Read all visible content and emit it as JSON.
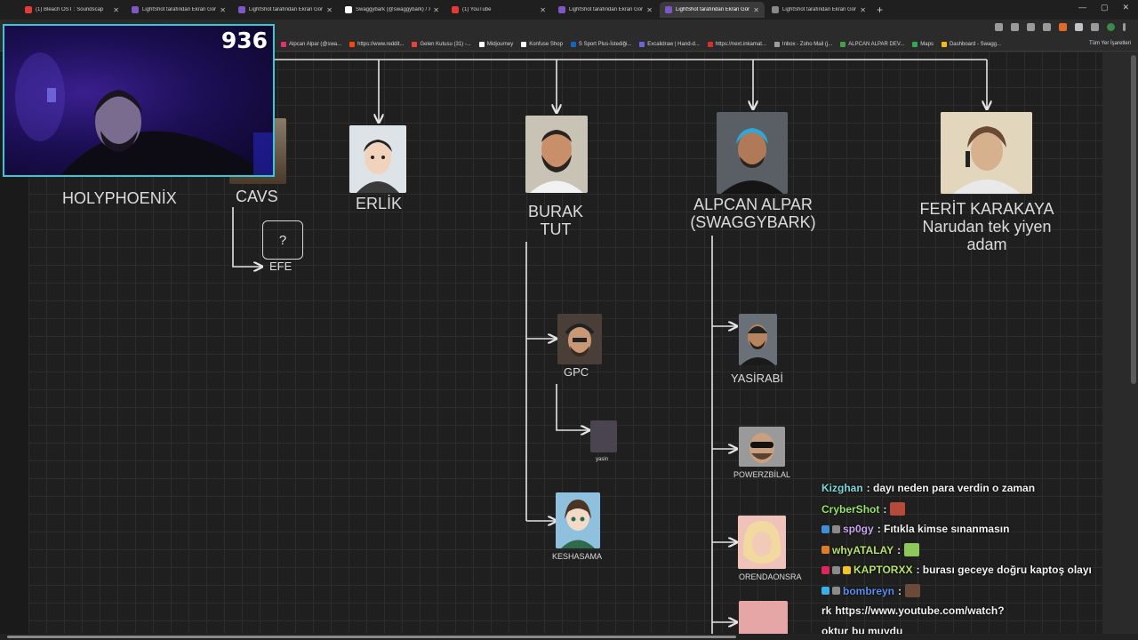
{
  "browser": {
    "tabs": [
      {
        "title": "(1) Bleach OST : Soundscap",
        "fav": "#e53935",
        "active": false
      },
      {
        "title": "LightShot tarafından Ekran Gör",
        "fav": "#7e57c2",
        "active": false
      },
      {
        "title": "LightShot tarafından Ekran Gör",
        "fav": "#7e57c2",
        "active": false
      },
      {
        "title": "Swaggybark (@swaggybark) / X",
        "fav": "#ffffff",
        "active": false
      },
      {
        "title": "(1) YouTube",
        "fav": "#e53935",
        "active": false
      },
      {
        "title": "LightShot tarafından Ekran Gör",
        "fav": "#7e57c2",
        "active": false
      },
      {
        "title": "LightShot tarafından Ekran Gör",
        "fav": "#7e57c2",
        "active": true
      },
      {
        "title": "LightShot tarafından Ekran Gör",
        "fav": "#888888",
        "active": false
      }
    ],
    "new_tab": "+",
    "window_controls": [
      "—",
      "▢",
      "✕"
    ],
    "bookmarks": [
      {
        "label": "Alpcan Alpar (@swa...",
        "color": "#e1306c"
      },
      {
        "label": "https://www.reddit...",
        "color": "#ff4500"
      },
      {
        "label": "Gelen Kutusu (31) -...",
        "color": "#ea4335"
      },
      {
        "label": "Midjourney",
        "color": "#ffffff"
      },
      {
        "label": "Konfuse Shop",
        "color": "#ffffff"
      },
      {
        "label": "S Sport Plus-İstediği...",
        "color": "#1565c0"
      },
      {
        "label": "Excalidraw | Hand-d...",
        "color": "#6965db"
      },
      {
        "label": "https://next.inkamat...",
        "color": "#d32f2f"
      },
      {
        "label": "Inbox - Zoho Mail (j...",
        "color": "#9e9e9e"
      },
      {
        "label": "ALPCAN ALPAR DEV...",
        "color": "#43a047"
      },
      {
        "label": "Maps",
        "color": "#34a853"
      },
      {
        "label": "Dashboard - Swagg...",
        "color": "#fbbc05"
      }
    ],
    "all_bookmarks": "Tüm Yer İşaretleri"
  },
  "diagram": {
    "nodes": {
      "holyphoenix": "HOLYPHOENİX",
      "cavs": "CAVS",
      "unknown": "?",
      "efe": "EFE",
      "erlik": "ERLİK",
      "burak": "BURAK\nTUT",
      "alpcan": "ALPCAN ALPAR\n(SWAGGYBARK)",
      "ferit": "FERİT KARAKAYA\nNarudan tek yiyen\nadam",
      "gpc": "GPC",
      "yasin": "yasin",
      "keshasama": "KESHASAMA",
      "yasirabi": "YASİRABİ",
      "powerzbilal": "POWERZBİLAL",
      "orendaonsra": "ORENDAONSRA"
    }
  },
  "stream": {
    "viewer_count": "936",
    "chat": [
      {
        "user": "Kizghan",
        "user_color": "#7fd8d8",
        "badges": [],
        "text": ": dayı neden para verdin o zaman",
        "emote": null
      },
      {
        "user": "CryberShot",
        "user_color": "#9be36b",
        "badges": [],
        "text": ":",
        "emote": "#b54a3a"
      },
      {
        "user": "sp0gy",
        "user_color": "#c9a6f2",
        "badges": [
          "#3d8fd6",
          "#8a8a8a"
        ],
        "text": ": Fıtıkla kimse sınanmasın",
        "emote": null
      },
      {
        "user": "whyATALAY",
        "user_color": "#b8e06c",
        "badges": [
          "#e07b2a"
        ],
        "text": ":",
        "emote": "#8ec85a"
      },
      {
        "user": "KAPTORXX",
        "user_color": "#b8e06c",
        "badges": [
          "#e0245e",
          "#8a8a8a",
          "#f2c12e"
        ],
        "text": ": burası geceye doğru kaptoş olayı",
        "emote": null
      },
      {
        "user": "bombreyn",
        "user_color": "#5a8ef0",
        "badges": [
          "#3ab0e8",
          "#8a8a8a"
        ],
        "text": ":",
        "emote": "#6b4a3a"
      },
      {
        "user": "rk",
        "user_color": "#f2f2f2",
        "badges": [],
        "text": "https://www.youtube.com/watch?",
        "emote": null
      },
      {
        "user": "oktur",
        "user_color": "#f2f2f2",
        "badges": [],
        "text": "bu muydu",
        "emote": null
      }
    ]
  }
}
